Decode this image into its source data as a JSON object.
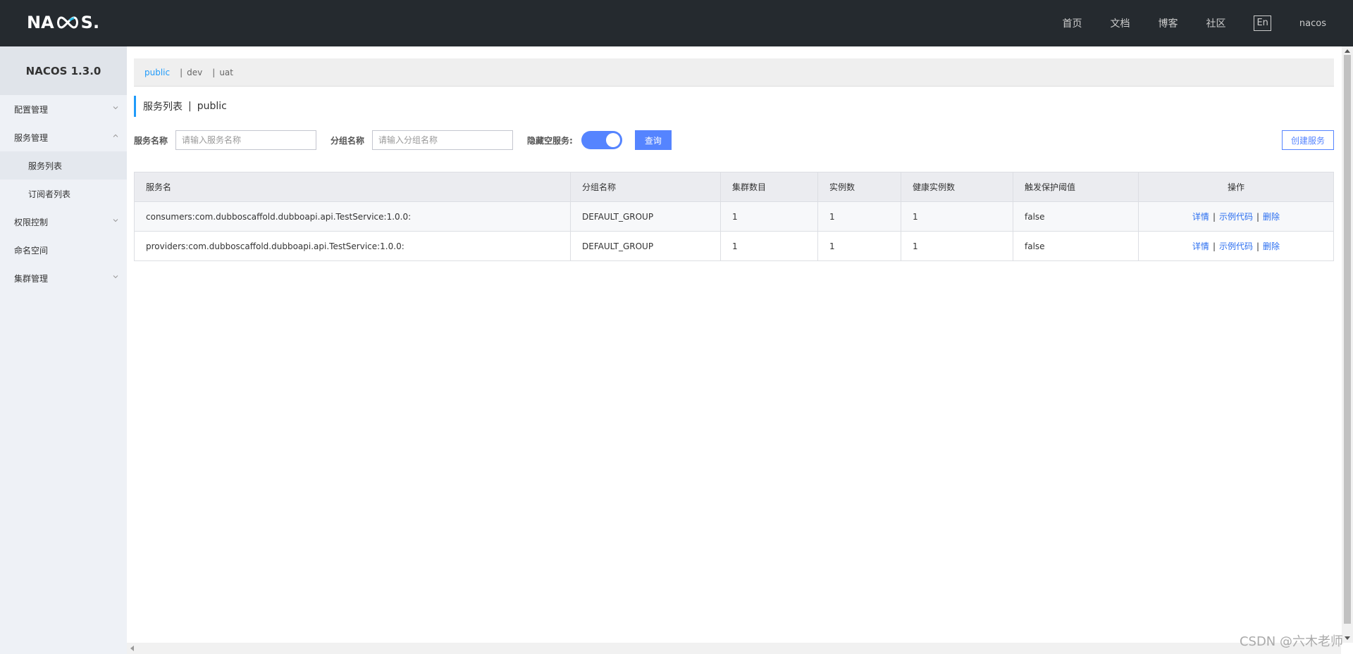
{
  "topbar": {
    "logo": "NACOS.",
    "nav": [
      "首页",
      "文档",
      "博客",
      "社区"
    ],
    "lang": "En",
    "user": "nacos"
  },
  "sidebar": {
    "version": "NACOS 1.3.0",
    "items": [
      {
        "label": "配置管理",
        "type": "group",
        "expanded": false
      },
      {
        "label": "服务管理",
        "type": "group",
        "expanded": true
      },
      {
        "label": "服务列表",
        "type": "sub",
        "active": true
      },
      {
        "label": "订阅者列表",
        "type": "sub"
      },
      {
        "label": "权限控制",
        "type": "group",
        "expanded": false
      },
      {
        "label": "命名空间",
        "type": "item"
      },
      {
        "label": "集群管理",
        "type": "group",
        "expanded": false
      }
    ]
  },
  "namespaces": {
    "items": [
      "public",
      "dev",
      "uat"
    ],
    "active": "public",
    "separator": "|"
  },
  "page_title": {
    "label": "服务列表",
    "divider": "|",
    "namespace": "public"
  },
  "filter": {
    "service_name_label": "服务名称",
    "service_name_placeholder": "请输入服务名称",
    "group_name_label": "分组名称",
    "group_name_placeholder": "请输入分组名称",
    "hide_empty_label": "隐藏空服务:",
    "hide_empty_on": true,
    "query_button": "查询",
    "create_button": "创建服务"
  },
  "table": {
    "headers": [
      "服务名",
      "分组名称",
      "集群数目",
      "实例数",
      "健康实例数",
      "触发保护阈值",
      "操作"
    ],
    "rows": [
      {
        "name": "consumers:com.dubboscaffold.dubboapi.api.TestService:1.0.0:",
        "group": "DEFAULT_GROUP",
        "clusters": "1",
        "instances": "1",
        "healthy": "1",
        "threshold": "false"
      },
      {
        "name": "providers:com.dubboscaffold.dubboapi.api.TestService:1.0.0:",
        "group": "DEFAULT_GROUP",
        "clusters": "1",
        "instances": "1",
        "healthy": "1",
        "threshold": "false"
      }
    ],
    "ops": {
      "detail": "详情",
      "sample": "示例代码",
      "delete": "删除",
      "separator": "|"
    }
  },
  "watermark": "CSDN @六木老师",
  "colors": {
    "topbar": "#252a2f",
    "accent": "#209bfa",
    "primary": "#5584ff",
    "sidebar": "#eef1f6"
  }
}
